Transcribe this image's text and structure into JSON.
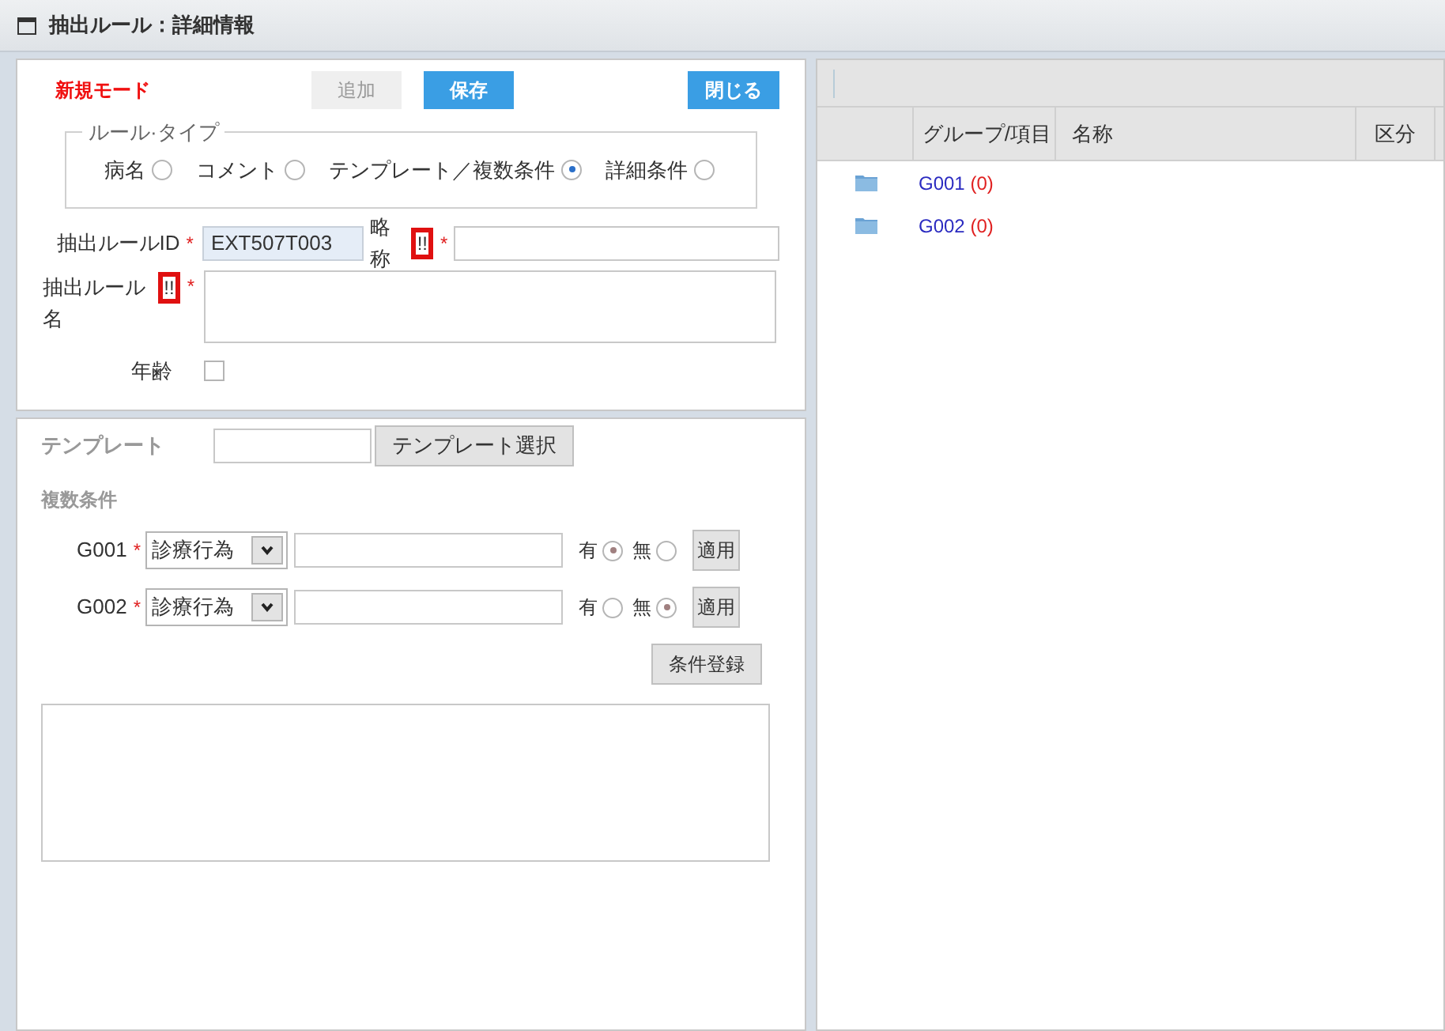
{
  "window": {
    "title": "抽出ルール：詳細情報"
  },
  "mode": "新規モード",
  "buttons": [
    {
      "label": "追加",
      "disabled": true
    },
    {
      "label": "保存",
      "disabled": false
    }
  ],
  "close_button": "閉じる",
  "rule_type": {
    "legend": "ルール·タイプ",
    "options": [
      {
        "label": "病名",
        "selected": false
      },
      {
        "label": "コメント",
        "selected": false
      },
      {
        "label": "テンプレート／複数条件",
        "selected": true
      },
      {
        "label": "詳細条件",
        "selected": false
      }
    ]
  },
  "rule_id": {
    "label": "抽出ルールID",
    "marker": "*",
    "value": "EXT507T003"
  },
  "abbreviation": {
    "label": "略称",
    "flag": "!!",
    "marker": "*"
  },
  "rule_name": {
    "label": "抽出ルール名",
    "flag": "!!",
    "marker": "*"
  },
  "age": {
    "label": "年齢",
    "checked": false
  },
  "template": {
    "label": "テンプレート",
    "button": "テンプレート選択"
  },
  "conditions": {
    "heading": "複数条件",
    "rows": [
      {
        "group": "G001",
        "marker": "*",
        "category": "診療行為",
        "options": [
          {
            "label": "有",
            "selected": true
          },
          {
            "label": "無",
            "selected": false
          }
        ],
        "apply": "適用"
      },
      {
        "group": "G002",
        "marker": "*",
        "category": "診療行為",
        "options": [
          {
            "label": "有",
            "selected": false
          },
          {
            "label": "無",
            "selected": true
          }
        ],
        "apply": "適用"
      }
    ],
    "register_button": "条件登録"
  },
  "table": {
    "columns": [
      "グループ/項目",
      "名称",
      "区分"
    ],
    "rows": [
      {
        "group": "G001",
        "count": "(0)"
      },
      {
        "group": "G002",
        "count": "(0)"
      }
    ]
  }
}
